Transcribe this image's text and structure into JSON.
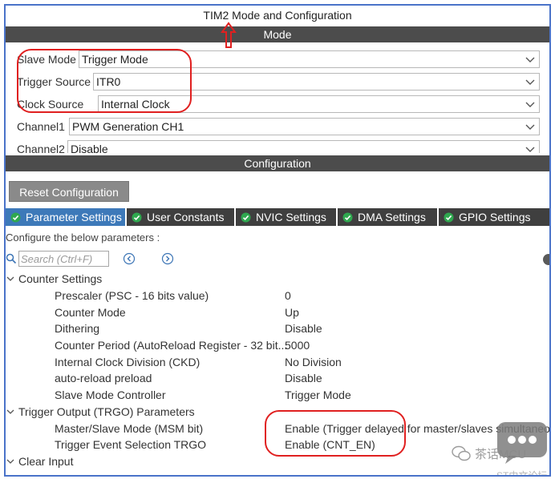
{
  "window": {
    "title": "TIM2 Mode and Configuration"
  },
  "mode_section": {
    "header": "Mode",
    "rows": [
      {
        "label": "Slave Mode",
        "value": "Trigger Mode"
      },
      {
        "label": "Trigger Source",
        "value": "ITR0"
      },
      {
        "label": "Clock Source",
        "value": "Internal Clock"
      },
      {
        "label": "Channel1",
        "value": "PWM Generation CH1"
      },
      {
        "label": "Channel2",
        "value": "Disable"
      }
    ]
  },
  "config_section": {
    "header": "Configuration",
    "reset_button": "Reset Configuration",
    "tabs": [
      {
        "label": "Parameter Settings",
        "active": true
      },
      {
        "label": "User Constants",
        "active": false
      },
      {
        "label": "NVIC Settings",
        "active": false
      },
      {
        "label": "DMA Settings",
        "active": false
      },
      {
        "label": "GPIO Settings",
        "active": false
      }
    ],
    "hint": "Configure the below parameters :",
    "search_placeholder": "Search (Ctrl+F)"
  },
  "groups": [
    {
      "title": "Counter Settings",
      "params": [
        {
          "name": "Prescaler (PSC - 16 bits value)",
          "value": "0"
        },
        {
          "name": "Counter Mode",
          "value": "Up"
        },
        {
          "name": "Dithering",
          "value": "Disable"
        },
        {
          "name": "Counter Period (AutoReload Register - 32 bit...",
          "value": "5000"
        },
        {
          "name": "Internal Clock Division (CKD)",
          "value": "No Division"
        },
        {
          "name": "auto-reload preload",
          "value": "Disable"
        },
        {
          "name": "Slave Mode Controller",
          "value": "Trigger Mode"
        }
      ]
    },
    {
      "title": "Trigger Output (TRGO) Parameters",
      "params": [
        {
          "name": "Master/Slave Mode (MSM bit)",
          "value": "Enable (Trigger delayed for master/slaves simultaneou"
        },
        {
          "name": "Trigger Event Selection TRGO",
          "value": "Enable (CNT_EN)"
        }
      ]
    },
    {
      "title": "Clear Input",
      "params": []
    }
  ],
  "watermark": {
    "text": "茶话MCU",
    "sub": "ST中文论坛"
  },
  "colors": {
    "accent_tab": "#3d79b9",
    "band": "#4c4c4c",
    "annotation": "#e02020",
    "frame": "#4a73c9"
  }
}
